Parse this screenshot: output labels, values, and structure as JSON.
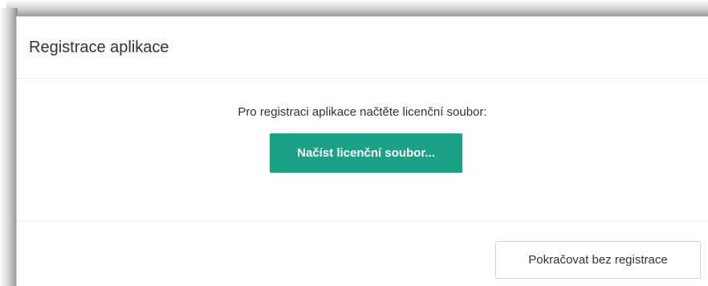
{
  "dialog": {
    "title": "Registrace aplikace",
    "prompt": "Pro registraci aplikace načtěte licenční soubor:",
    "load_button_label": "Načíst licenční soubor...",
    "continue_button_label": "Pokračovat bez registrace"
  },
  "colors": {
    "primary_button": "#1ba286",
    "primary_button_text": "#ffffff",
    "text": "#333333",
    "divider": "#e9ecef"
  }
}
